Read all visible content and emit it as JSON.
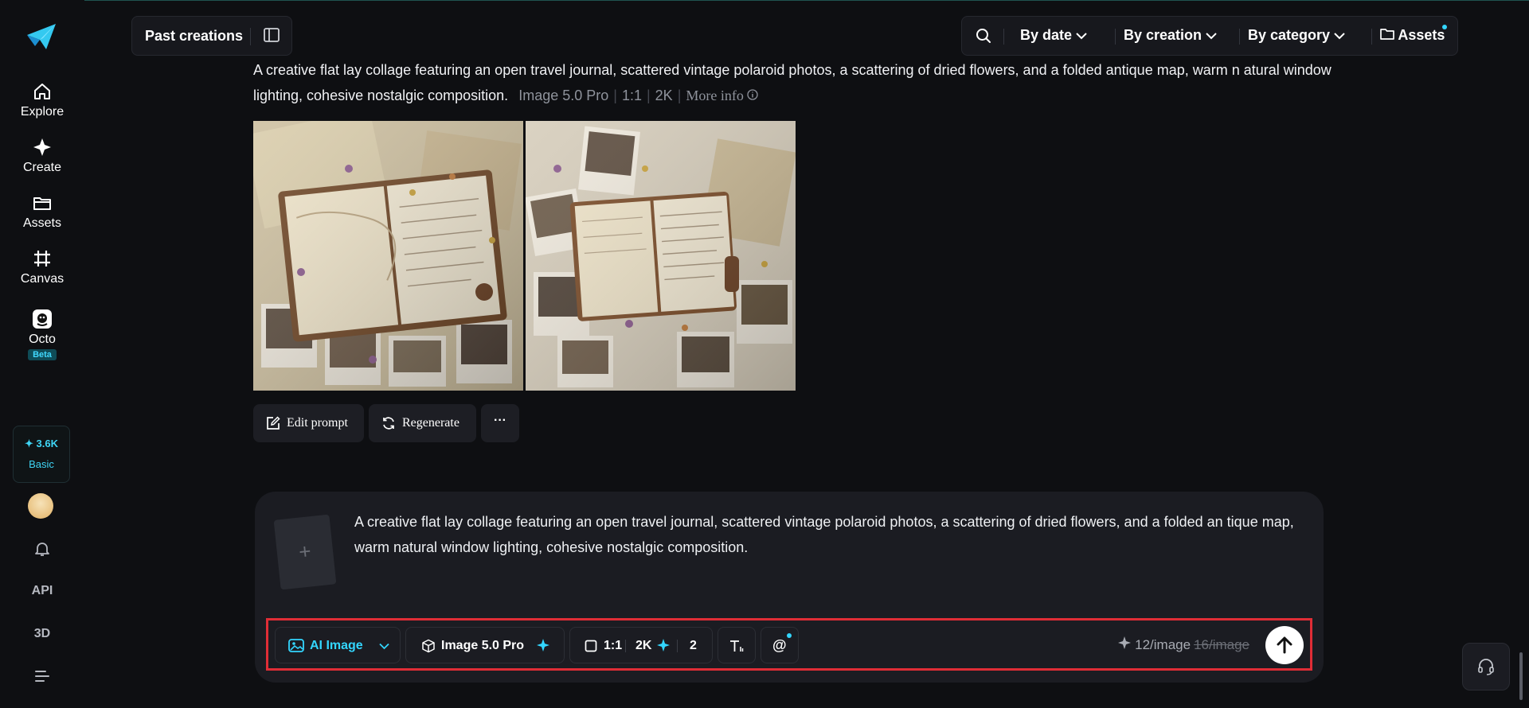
{
  "sidebar": {
    "items": [
      {
        "label": "Explore",
        "icon": "home-icon"
      },
      {
        "label": "Create",
        "icon": "sparkle-icon"
      },
      {
        "label": "Assets",
        "icon": "folder-icon"
      },
      {
        "label": "Canvas",
        "icon": "canvas-icon"
      },
      {
        "label": "Octo",
        "icon": "octo-icon",
        "badge": "Beta"
      }
    ],
    "credits": {
      "amount": "✦ 3.6K",
      "plan": "Basic"
    },
    "bottom": {
      "api": "API",
      "three_d": "3D"
    }
  },
  "topbar": {
    "past_creations": "Past creations",
    "filters": [
      "By date",
      "By creation",
      "By category"
    ],
    "assets": "Assets"
  },
  "generation": {
    "prompt": "A creative flat lay collage featuring an open travel journal, scattered vintage polaroid photos, a scattering of dried flowers, and a folded antique map, warm n atural window lighting, cohesive nostalgic composition.",
    "model": "Image 5.0 Pro",
    "ratio": "1:1",
    "resolution": "2K",
    "more_info": "More info",
    "actions": {
      "edit": "Edit prompt",
      "regenerate": "Regenerate",
      "more": "···"
    }
  },
  "composer": {
    "add_symbol": "+",
    "text": "A creative flat lay collage featuring an open travel journal, scattered vintage polaroid photos, a scattering of dried flowers, and a folded an tique map, warm natural window lighting, cohesive nostalgic composition.",
    "toolbar": {
      "mode": "AI Image",
      "model": "Image 5.0 Pro",
      "ratio": "1:1",
      "resolution": "2K",
      "count": "2",
      "mention": "@",
      "cost": "12/image",
      "old_cost": "16/image"
    }
  },
  "colors": {
    "accent": "#33d6ff",
    "highlight_border": "#e02d36",
    "background": "#0e0f12"
  }
}
